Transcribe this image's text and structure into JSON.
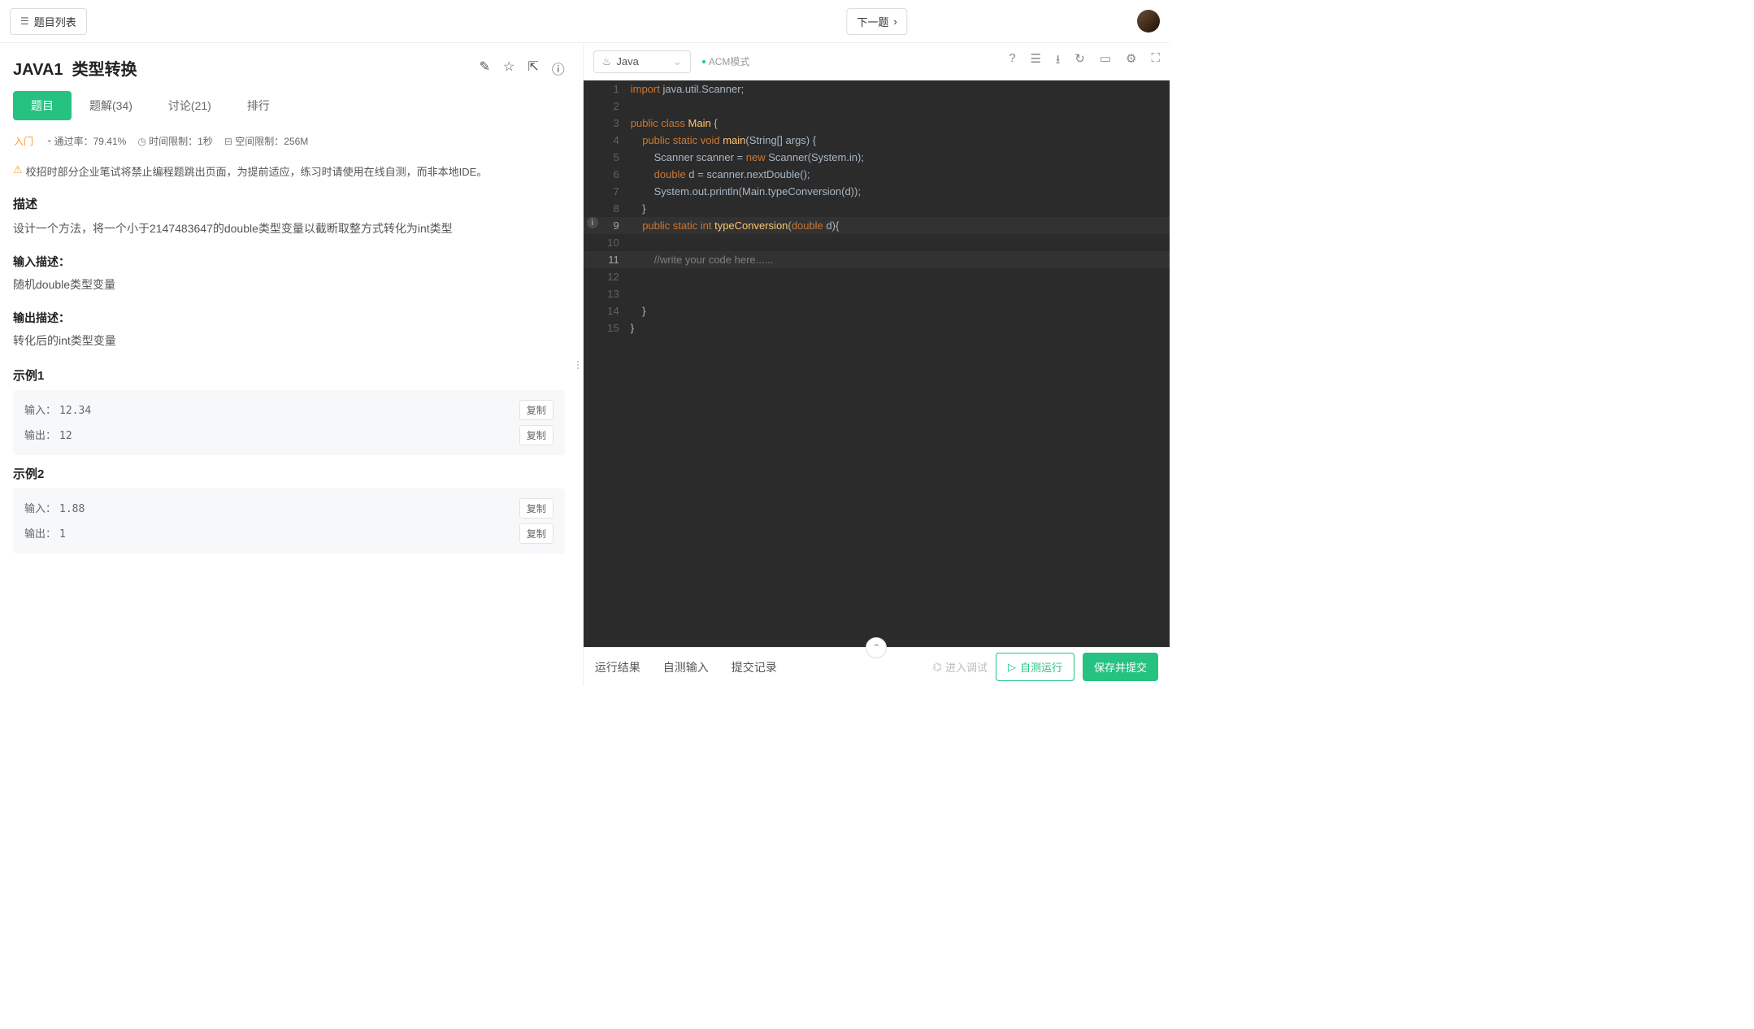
{
  "topbar": {
    "list_btn": "题目列表",
    "next_btn": "下一题"
  },
  "problem": {
    "code": "JAVA1",
    "name": "类型转换",
    "tabs": {
      "problem": "题目",
      "solution": "题解(34)",
      "discuss": "讨论(21)",
      "rank": "排行"
    },
    "level": "入门",
    "pass_label": "通过率：",
    "pass_val": "79.41%",
    "time_label": "时间限制：",
    "time_val": "1秒",
    "mem_label": "空间限制：",
    "mem_val": "256M",
    "warning": "校招时部分企业笔试将禁止编程题跳出页面，为提前适应，练习时请使用在线自测，而非本地IDE。",
    "desc_h": "描述",
    "desc": "设计一个方法，将一个小于2147483647的double类型变量以截断取整方式转化为int类型",
    "in_h": "输入描述：",
    "in_d": "随机double类型变量",
    "out_h": "输出描述：",
    "out_d": "转化后的int类型变量",
    "ex1_h": "示例1",
    "ex2_h": "示例2",
    "in_lbl": "输入：",
    "out_lbl": "输出：",
    "copy": "复制",
    "ex1_in": "12.34",
    "ex1_out": "12",
    "ex2_in": "1.88",
    "ex2_out": "1"
  },
  "editor": {
    "lang": "Java",
    "mode": "ACM模式",
    "bottom_tabs": {
      "result": "运行结果",
      "input": "自测输入",
      "record": "提交记录"
    },
    "debug": "进入调试",
    "run": "自测运行",
    "submit": "保存并提交",
    "lines": [
      {
        "n": 1,
        "tokens": [
          {
            "t": "import ",
            "c": "kw"
          },
          {
            "t": "java.util.Scanner;",
            "c": ""
          }
        ]
      },
      {
        "n": 2,
        "tokens": []
      },
      {
        "n": 3,
        "tokens": [
          {
            "t": "public class ",
            "c": "kw"
          },
          {
            "t": "Main ",
            "c": "yel"
          },
          {
            "t": "{",
            "c": ""
          }
        ]
      },
      {
        "n": 4,
        "tokens": [
          {
            "t": "    ",
            "c": ""
          },
          {
            "t": "public static ",
            "c": "kw"
          },
          {
            "t": "void ",
            "c": "kw"
          },
          {
            "t": "main",
            "c": "yel"
          },
          {
            "t": "(String[] args) {",
            "c": ""
          }
        ]
      },
      {
        "n": 5,
        "tokens": [
          {
            "t": "        Scanner scanner = ",
            "c": ""
          },
          {
            "t": "new ",
            "c": "kw"
          },
          {
            "t": "Scanner(System.in);",
            "c": ""
          }
        ]
      },
      {
        "n": 6,
        "tokens": [
          {
            "t": "        ",
            "c": ""
          },
          {
            "t": "double ",
            "c": "kw"
          },
          {
            "t": "d = scanner.nextDouble();",
            "c": ""
          }
        ]
      },
      {
        "n": 7,
        "tokens": [
          {
            "t": "        System.out.println(Main.typeConversion(d));",
            "c": ""
          }
        ]
      },
      {
        "n": 8,
        "tokens": [
          {
            "t": "    }",
            "c": ""
          }
        ]
      },
      {
        "n": 9,
        "hl": true,
        "bulb": true,
        "tokens": [
          {
            "t": "    ",
            "c": ""
          },
          {
            "t": "public static ",
            "c": "kw"
          },
          {
            "t": "int ",
            "c": "kw"
          },
          {
            "t": "typeConversion",
            "c": "yel"
          },
          {
            "t": "(",
            "c": ""
          },
          {
            "t": "double ",
            "c": "kw"
          },
          {
            "t": "d)",
            "c": ""
          },
          {
            "t": "{",
            "c": "",
            "err": true
          }
        ]
      },
      {
        "n": 10,
        "tokens": []
      },
      {
        "n": 11,
        "hl": true,
        "tokens": [
          {
            "t": "        ",
            "c": ""
          },
          {
            "t": "//write your code here......",
            "c": "cmt"
          }
        ]
      },
      {
        "n": 12,
        "tokens": []
      },
      {
        "n": 13,
        "tokens": []
      },
      {
        "n": 14,
        "tokens": [
          {
            "t": "    }",
            "c": ""
          }
        ]
      },
      {
        "n": 15,
        "tokens": [
          {
            "t": "}",
            "c": ""
          }
        ]
      }
    ]
  }
}
